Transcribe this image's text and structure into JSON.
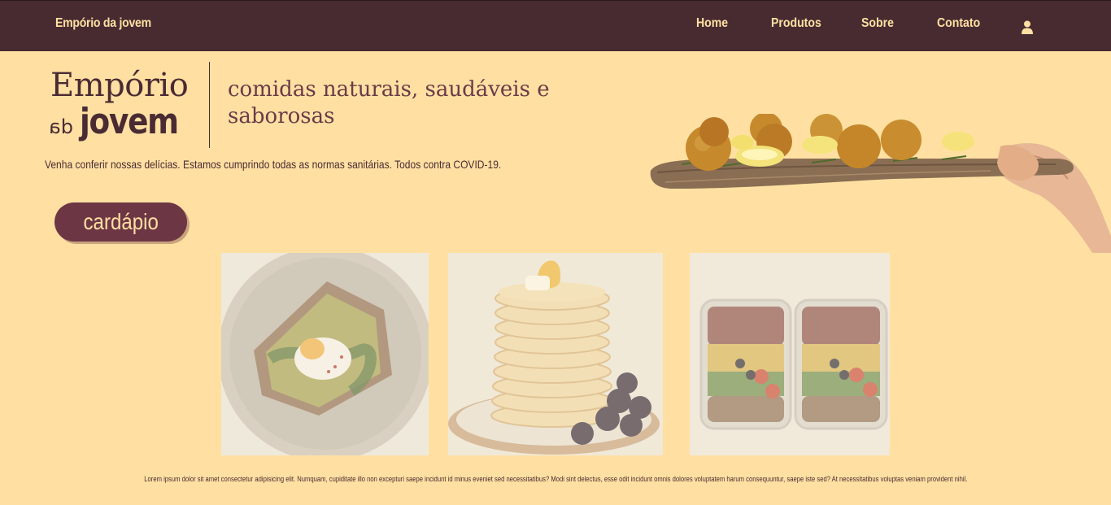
{
  "nav": {
    "brand": "Empório da jovem",
    "items": [
      {
        "label": "Home"
      },
      {
        "label": "Produtos"
      },
      {
        "label": "Sobre"
      },
      {
        "label": "Contato"
      }
    ],
    "user_icon": "user-icon"
  },
  "logo": {
    "top": "Empório",
    "da": "da",
    "bottom": "jovem"
  },
  "hero": {
    "tagline": "comidas naturais, saudáveis e saborosas",
    "intro": "Venha conferir nossas delícias. Estamos cumprindo todas as normas sanitárias. Todos contra COVID-19.",
    "button_label": "cardápio"
  },
  "gallery": {
    "images": [
      "avocado-toast-image",
      "pancakes-image",
      "meal-prep-image"
    ]
  },
  "footer": {
    "text": "Lorem ipsum dolor sit amet consectetur adipisicing elit. Numquam, cupiditate illo non excepturi saepe incidunt id minus eveniet sed necessitatibus? Modi sint delectus, esse odit incidunt omnis dolores voluptatem harum consequuntur, saepe iste sed? At necessitatibus voluptas veniam provident nihil."
  },
  "colors": {
    "background": "#ffe0a2",
    "navbar": "#472b31",
    "accent": "#6d3644",
    "text": "#4a2b33"
  }
}
